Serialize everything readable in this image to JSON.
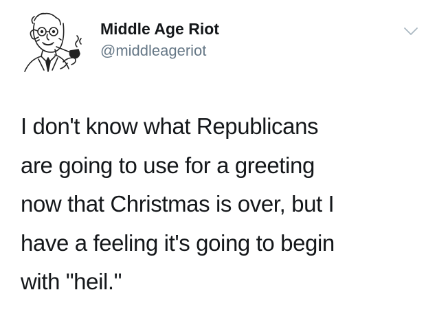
{
  "author": {
    "display_name": "Middle Age Riot",
    "handle": "@middleageriot",
    "avatar_icon": "man-with-pipe-drawing"
  },
  "menu": {
    "icon": "chevron-down-icon"
  },
  "tweet": {
    "text": "I don't know what Republicans\nare going to use for a greeting\nnow that Christmas is over, but I\nhave a feeling it's going to begin\nwith \"heil.\""
  },
  "colors": {
    "text": "#14171a",
    "secondary": "#657786",
    "chevron": "#aab8c2"
  }
}
